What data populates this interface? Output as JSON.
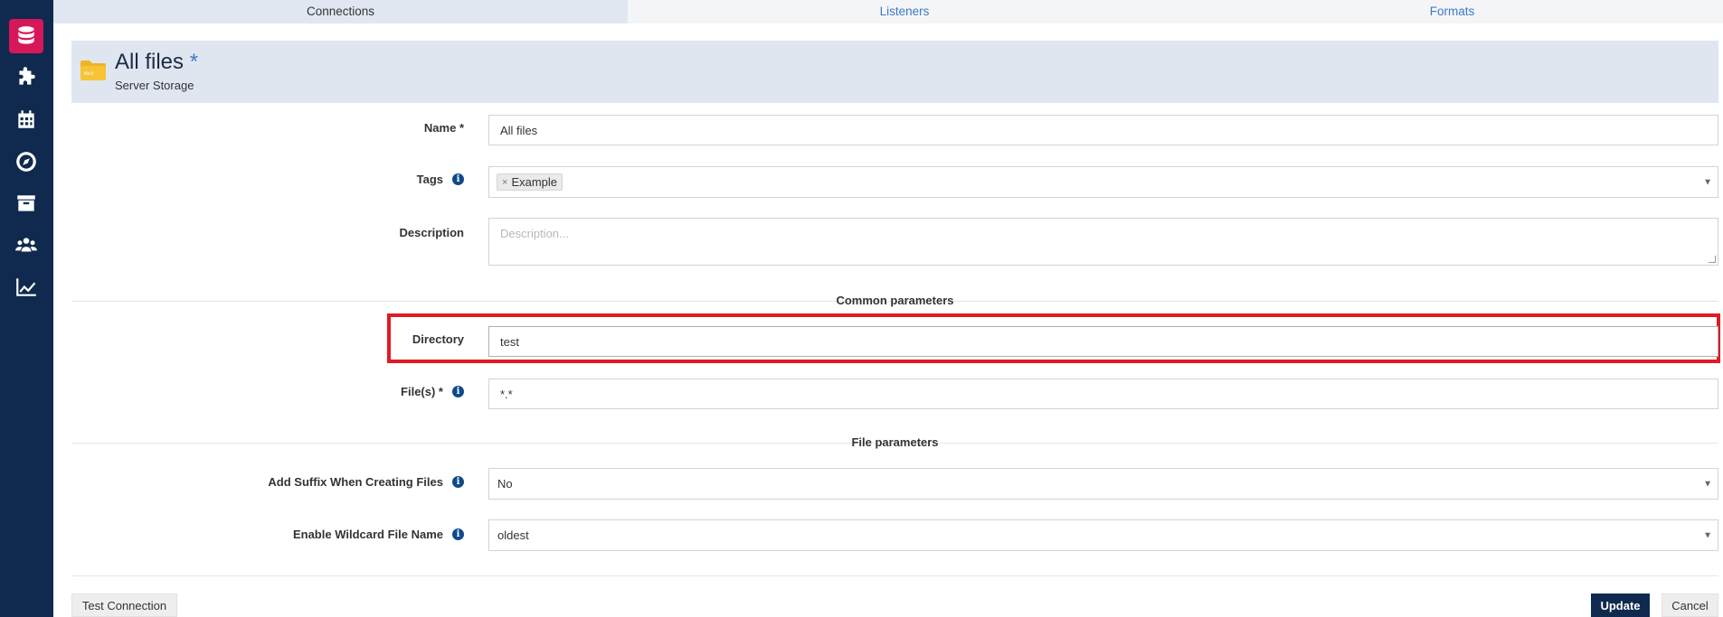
{
  "tabs": [
    {
      "label": "Connections"
    },
    {
      "label": "Listeners"
    },
    {
      "label": "Formats"
    }
  ],
  "sidebar": {
    "items": [
      {
        "icon": "database-icon",
        "active": true
      },
      {
        "icon": "puzzle-icon"
      },
      {
        "icon": "calendar-icon"
      },
      {
        "icon": "compass-icon"
      },
      {
        "icon": "archive-icon"
      },
      {
        "icon": "users-icon"
      },
      {
        "icon": "chart-line-icon"
      }
    ]
  },
  "header": {
    "title": "All files",
    "title_marker": "*",
    "subtitle": "Server Storage",
    "folder_label": "file://"
  },
  "form": {
    "name": {
      "label": "Name *",
      "value": "All files"
    },
    "tags": {
      "label": "Tags",
      "tag": "Example",
      "remove": "×"
    },
    "description": {
      "label": "Description",
      "placeholder": "Description..."
    },
    "common_section": "Common parameters",
    "directory": {
      "label": "Directory",
      "value": "test"
    },
    "files": {
      "label": "File(s) *",
      "value": "*.*"
    },
    "file_section": "File parameters",
    "add_suffix": {
      "label": "Add Suffix When Creating Files",
      "value": "No"
    },
    "wildcard": {
      "label": "Enable Wildcard File Name",
      "value": "oldest"
    }
  },
  "buttons": {
    "test_connection": "Test Connection",
    "update": "Update",
    "cancel": "Cancel"
  },
  "colors": {
    "sidebar_bg": "#0f2a4e",
    "active_icon_bg": "#d6185a",
    "highlight": "#e01b24",
    "link": "#3e7ac4"
  }
}
